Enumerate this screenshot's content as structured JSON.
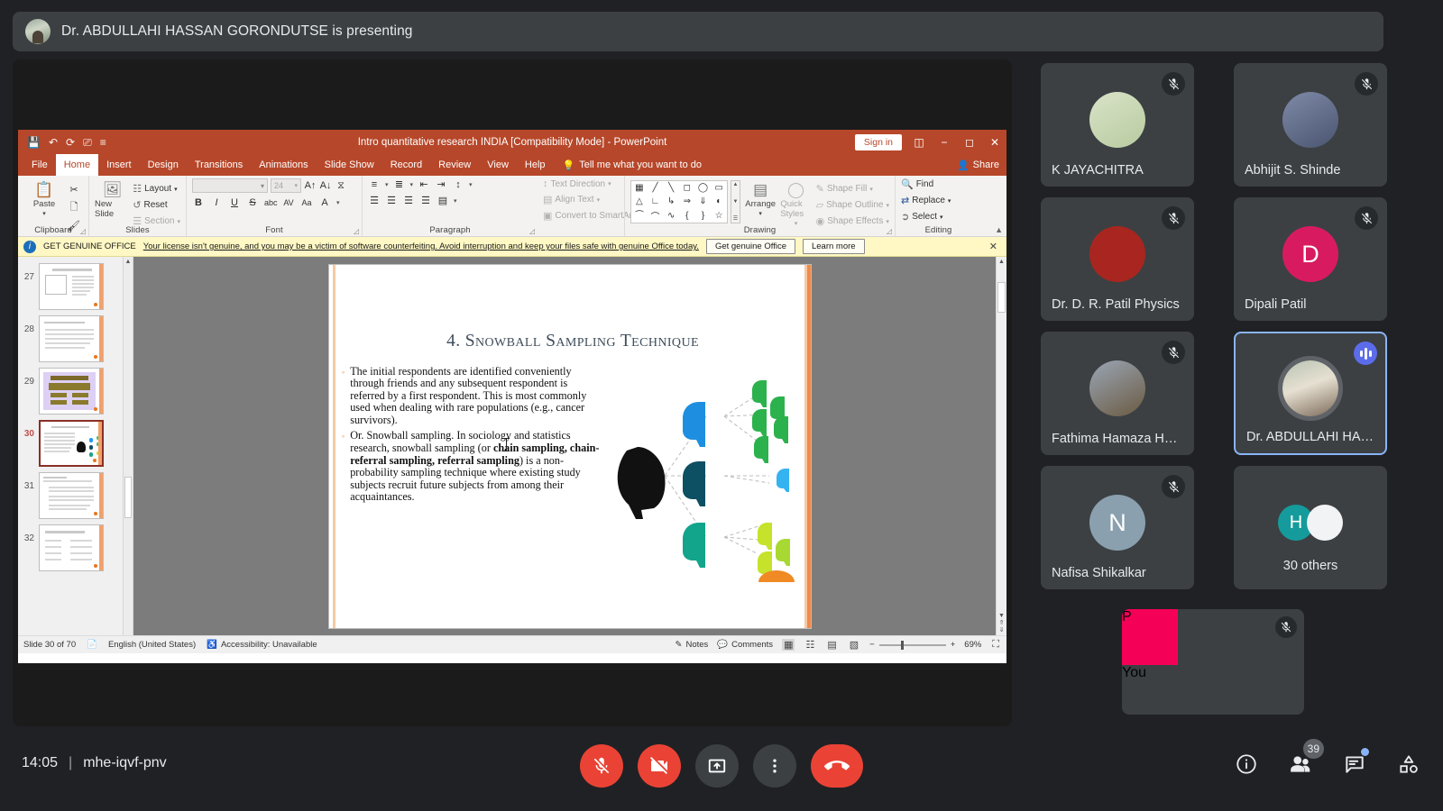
{
  "meet": {
    "presenting_banner": "Dr. ABDULLAHI HASSAN GORONDUTSE is presenting",
    "time": "14:05",
    "divider": "|",
    "meeting_code": "mhe-iqvf-pnv",
    "participant_count": "39",
    "controls": [
      {
        "name": "microphone-off-button",
        "icon": "mic-off-icon"
      },
      {
        "name": "camera-off-button",
        "icon": "camera-off-icon"
      },
      {
        "name": "present-now-button",
        "icon": "present-screen-icon"
      },
      {
        "name": "more-options-button",
        "icon": "more-vertical-icon"
      },
      {
        "name": "leave-call-button",
        "icon": "hangup-icon"
      }
    ],
    "right_controls": [
      {
        "name": "meeting-details-button",
        "icon": "info-icon"
      },
      {
        "name": "show-everyone-button",
        "icon": "people-icon"
      },
      {
        "name": "chat-button",
        "icon": "chat-icon"
      },
      {
        "name": "activities-button",
        "icon": "activities-icon"
      }
    ],
    "participants": [
      {
        "name": "K JAYACHITRA",
        "avatar_type": "photo",
        "avatar_color": "#b9c7a6",
        "initial": "K",
        "muted": true,
        "speaking": false
      },
      {
        "name": "Abhijit S. Shinde",
        "avatar_type": "photo",
        "avatar_color": "#5a6a8a",
        "initial": "A",
        "muted": true,
        "speaking": false
      },
      {
        "name": "Dr. D. R. Patil Physics",
        "avatar_type": "photo",
        "avatar_color": "#a8261f",
        "initial": "D",
        "muted": true,
        "speaking": false
      },
      {
        "name": "Dipali Patil",
        "avatar_type": "initial",
        "avatar_color": "#d81b60",
        "initial": "D",
        "muted": true,
        "speaking": false
      },
      {
        "name": "Fathima Hamaza Hassee…",
        "avatar_type": "photo",
        "avatar_color": "#8d7154",
        "initial": "F",
        "muted": true,
        "speaking": false
      },
      {
        "name": "Dr. ABDULLAHI HASSAN …",
        "avatar_type": "photo",
        "avatar_color": "#9aa89b",
        "initial": "A",
        "muted": false,
        "speaking": true
      },
      {
        "name": "Nafisa Shikalkar",
        "avatar_type": "initial",
        "avatar_color": "#8aa0ae",
        "initial": "N",
        "muted": true,
        "speaking": false
      },
      {
        "name": "30 others",
        "avatar_type": "group",
        "avatar_color": "#159b9b",
        "initial": "H",
        "muted": false,
        "speaking": false
      }
    ],
    "self_tile": {
      "name": "You",
      "initial": "P",
      "avatar_color": "#f50057",
      "muted": true
    }
  },
  "powerpoint": {
    "title_bar": {
      "document_title": "Intro quantitative research INDIA [Compatibility Mode]  -  PowerPoint",
      "sign_in": "Sign in",
      "quick_access": [
        "save-icon",
        "undo-icon",
        "redo-icon",
        "start-slideshow-icon",
        "customize-qat-icon"
      ],
      "window_buttons": [
        "ribbon-display-options-icon",
        "minimize-icon",
        "restore-icon",
        "close-icon"
      ]
    },
    "tabs": [
      {
        "label": "File",
        "active": false
      },
      {
        "label": "Home",
        "active": true
      },
      {
        "label": "Insert",
        "active": false
      },
      {
        "label": "Design",
        "active": false
      },
      {
        "label": "Transitions",
        "active": false
      },
      {
        "label": "Animations",
        "active": false
      },
      {
        "label": "Slide Show",
        "active": false
      },
      {
        "label": "Record",
        "active": false
      },
      {
        "label": "Review",
        "active": false
      },
      {
        "label": "View",
        "active": false
      },
      {
        "label": "Help",
        "active": false
      }
    ],
    "tell_me": "Tell me what you want to do",
    "share_label": "Share",
    "ribbon": {
      "clipboard": {
        "label": "Clipboard",
        "paste": "Paste",
        "items": [
          "cut-icon",
          "copy-icon",
          "format-painter-icon"
        ]
      },
      "slides": {
        "label": "Slides",
        "new_slide": "New Slide",
        "layout": "Layout",
        "reset": "Reset",
        "section": "Section"
      },
      "font": {
        "label": "Font",
        "font_name": "",
        "font_size": "24",
        "buttons": [
          "B",
          "I",
          "U",
          "S",
          "abc",
          "AV",
          "Aa",
          "A"
        ]
      },
      "paragraph": {
        "label": "Paragraph",
        "text_direction": "Text Direction",
        "align_text": "Align Text",
        "convert_smartart": "Convert to SmartArt"
      },
      "drawing": {
        "label": "Drawing",
        "arrange": "Arrange",
        "quick_styles": "Quick Styles",
        "shape_fill": "Shape Fill",
        "shape_outline": "Shape Outline",
        "shape_effects": "Shape Effects"
      },
      "editing": {
        "label": "Editing",
        "find": "Find",
        "replace": "Replace",
        "select": "Select"
      }
    },
    "genuine_bar": {
      "lead": "GET GENUINE OFFICE",
      "message": "Your license isn't genuine, and you may be a victim of software counterfeiting. Avoid interruption and keep your files safe with genuine Office today.",
      "primary_button": "Get genuine Office",
      "secondary_button": "Learn more",
      "close": "✕"
    },
    "thumbnails": [
      {
        "number": "27",
        "selected": false
      },
      {
        "number": "28",
        "selected": false
      },
      {
        "number": "29",
        "selected": false
      },
      {
        "number": "30",
        "selected": true
      },
      {
        "number": "31",
        "selected": false
      },
      {
        "number": "32",
        "selected": false
      }
    ],
    "slide": {
      "title": "4. Snowball Sampling Technique",
      "bullets": [
        {
          "prefix": "The initial respondents are identified conveniently through friends and any subsequent respondent is referred by a first respondent. This is most commonly used when dealing with rare populations (e.g., cancer survivors).",
          "bold": "",
          "suffix": ""
        },
        {
          "prefix": "Or. Snowball sampling. In sociology and statistics research, snowball sampling (or ",
          "bold": "chain sampling, chain-referral sampling, referral sampling",
          "suffix": ") is a non-probability sampling technique where existing study subjects recruit future subjects from among their acquaintances."
        }
      ]
    },
    "status_bar": {
      "slide_counter": "Slide 30 of 70",
      "language": "English (United States)",
      "accessibility": "Accessibility: Unavailable",
      "notes": "Notes",
      "comments": "Comments",
      "zoom_level": "69%",
      "zoom_out": "−",
      "zoom_in": "+",
      "views": [
        "normal-view-icon",
        "slide-sorter-icon",
        "reading-view-icon",
        "slideshow-icon"
      ]
    }
  }
}
